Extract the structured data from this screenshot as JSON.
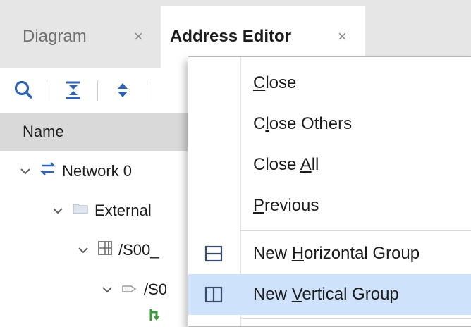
{
  "tabs": [
    {
      "label": "Diagram",
      "close": "×"
    },
    {
      "label": "Address Editor",
      "close": "×"
    }
  ],
  "table": {
    "header": "Name",
    "rows": [
      {
        "label": "Network 0"
      },
      {
        "label": "External"
      },
      {
        "label": "/S00_"
      },
      {
        "label": "/S0"
      }
    ]
  },
  "menu": {
    "items": [
      {
        "pre": "",
        "u": "C",
        "post": "lose"
      },
      {
        "pre": "C",
        "u": "l",
        "post": "ose Others"
      },
      {
        "pre": "Close ",
        "u": "A",
        "post": "ll"
      },
      {
        "pre": "",
        "u": "P",
        "post": "revious"
      },
      {
        "pre": "New ",
        "u": "H",
        "post": "orizontal Group"
      },
      {
        "pre": "New ",
        "u": "V",
        "post": "ertical Group"
      }
    ]
  },
  "colors": {
    "highlight": "#cfe2fb",
    "tree_icon_blue": "#2f63b5",
    "tree_icon_green": "#3a9d3a",
    "folder_icon": "#b7c3cf"
  },
  "icons": {
    "toolbar": [
      "search-icon",
      "collapse-all-icon",
      "expand-all-icon"
    ],
    "menu": [
      "horizontal-group-icon",
      "vertical-group-icon"
    ]
  }
}
